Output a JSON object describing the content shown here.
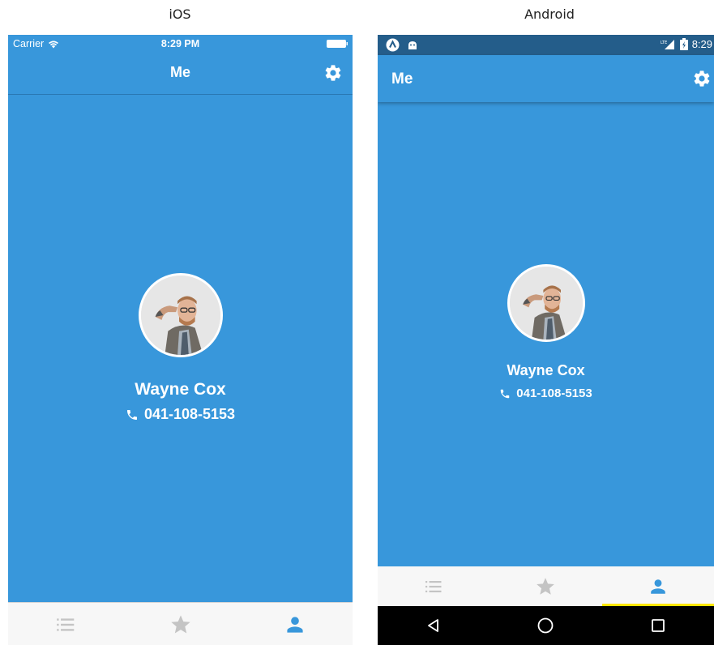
{
  "labels": {
    "ios": "iOS",
    "android": "Android"
  },
  "colors": {
    "background": "#3897DB",
    "android_status": "#245D8A",
    "tab_active": "#3897DB",
    "tab_inactive": "#c4c4c4",
    "android_indicator": "#FFE600"
  },
  "ios": {
    "status": {
      "carrier": "Carrier",
      "time": "8:29 PM"
    },
    "nav": {
      "title": "Me",
      "settings_icon": "gear-icon"
    },
    "profile": {
      "name": "Wayne Cox",
      "phone": "041-108-5153",
      "phone_icon": "phone-icon"
    },
    "tabs": [
      {
        "icon": "list-icon",
        "active": false
      },
      {
        "icon": "star-icon",
        "active": false
      },
      {
        "icon": "person-icon",
        "active": true
      }
    ]
  },
  "android": {
    "status": {
      "time": "8:29",
      "network": "LTE"
    },
    "appbar": {
      "title": "Me",
      "settings_icon": "gear-icon"
    },
    "profile": {
      "name": "Wayne Cox",
      "phone": "041-108-5153",
      "phone_icon": "phone-icon"
    },
    "tabs": [
      {
        "icon": "list-icon",
        "active": false
      },
      {
        "icon": "star-icon",
        "active": false
      },
      {
        "icon": "person-icon",
        "active": true
      }
    ],
    "navbar": [
      "back-icon",
      "home-icon",
      "recents-icon"
    ]
  }
}
